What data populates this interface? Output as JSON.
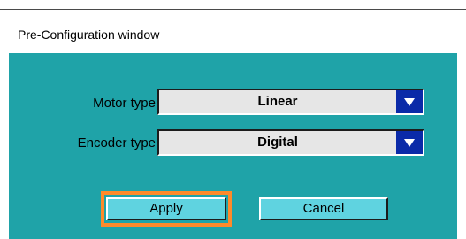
{
  "window": {
    "title": "Pre-Configuration window"
  },
  "form": {
    "motor_label": "Motor type",
    "motor_value": "Linear",
    "encoder_label": "Encoder type",
    "encoder_value": "Digital"
  },
  "buttons": {
    "apply_label": "Apply",
    "cancel_label": "Cancel"
  },
  "icons": {
    "dropdown": "triangle-down-icon"
  },
  "colors": {
    "panel_background": "#1fa3a8",
    "dropdown_arrow_background": "#0a2aa8",
    "button_background": "#5fd3e0",
    "focus_ring": "#ff8a2a",
    "select_background": "#e6e6e6"
  }
}
